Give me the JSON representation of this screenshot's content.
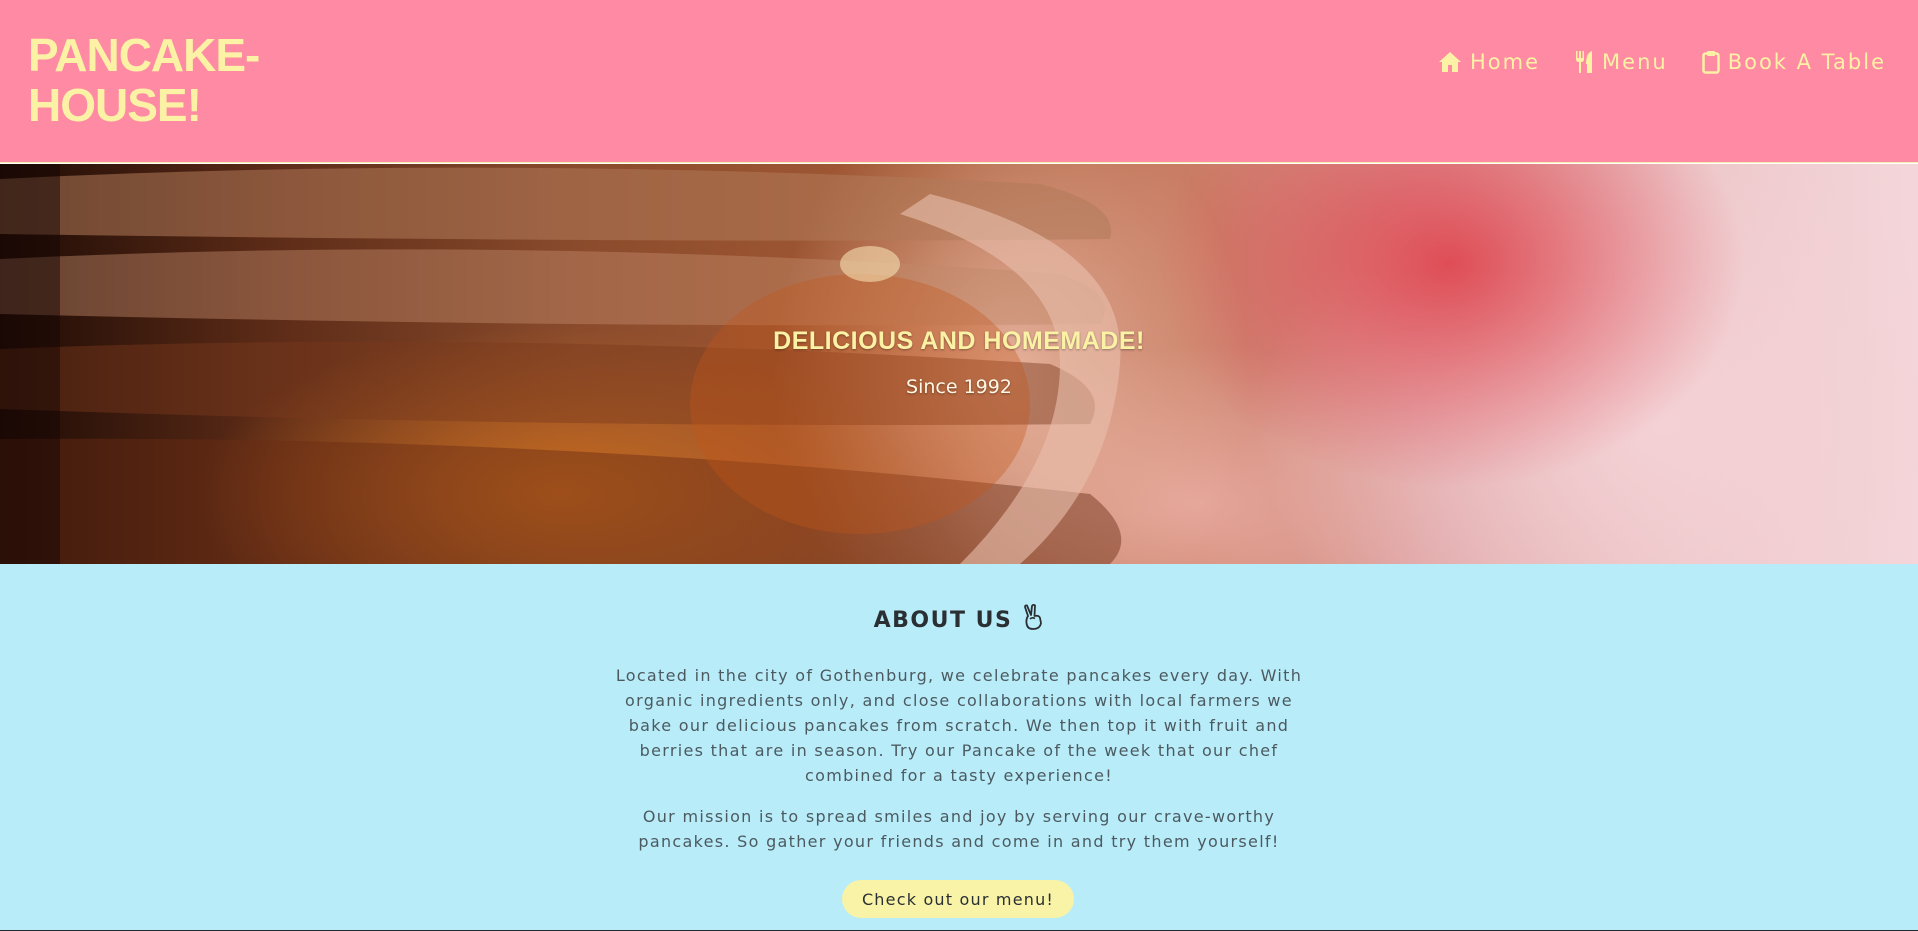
{
  "brand": {
    "logo_text": "PANCAKE-HOUSE!"
  },
  "nav": {
    "items": [
      {
        "label": "Home",
        "icon": "home-icon"
      },
      {
        "label": "Menu",
        "icon": "utensils-icon"
      },
      {
        "label": "Book A Table",
        "icon": "clipboard-icon"
      }
    ]
  },
  "hero": {
    "title": "DELICIOUS AND HOMEMADE!",
    "subtitle": "Since 1992"
  },
  "about": {
    "title": "ABOUT US",
    "title_icon": "peace-hand-icon",
    "paragraph_1": "Located in the city of Gothenburg, we celebrate pancakes every day. With organic ingredients only, and close collaborations with local farmers we bake our delicious pancakes from scratch. We then top it with fruit and berries that are in season. Try our Pancake of the week that our chef combined for a tasty experience!",
    "paragraph_2": "Our mission is to spread smiles and joy by serving our crave-worthy pancakes. So gather your friends and come in and try them yourself!",
    "cta_label": "Check out our menu!"
  },
  "colors": {
    "header_bg": "#ff8aa3",
    "accent_yellow": "#fbf2a6",
    "about_bg": "#b8ecf9",
    "button_bg": "#f8f3a6",
    "text_dark": "#2a2f33",
    "text_body": "#4c5a60"
  }
}
